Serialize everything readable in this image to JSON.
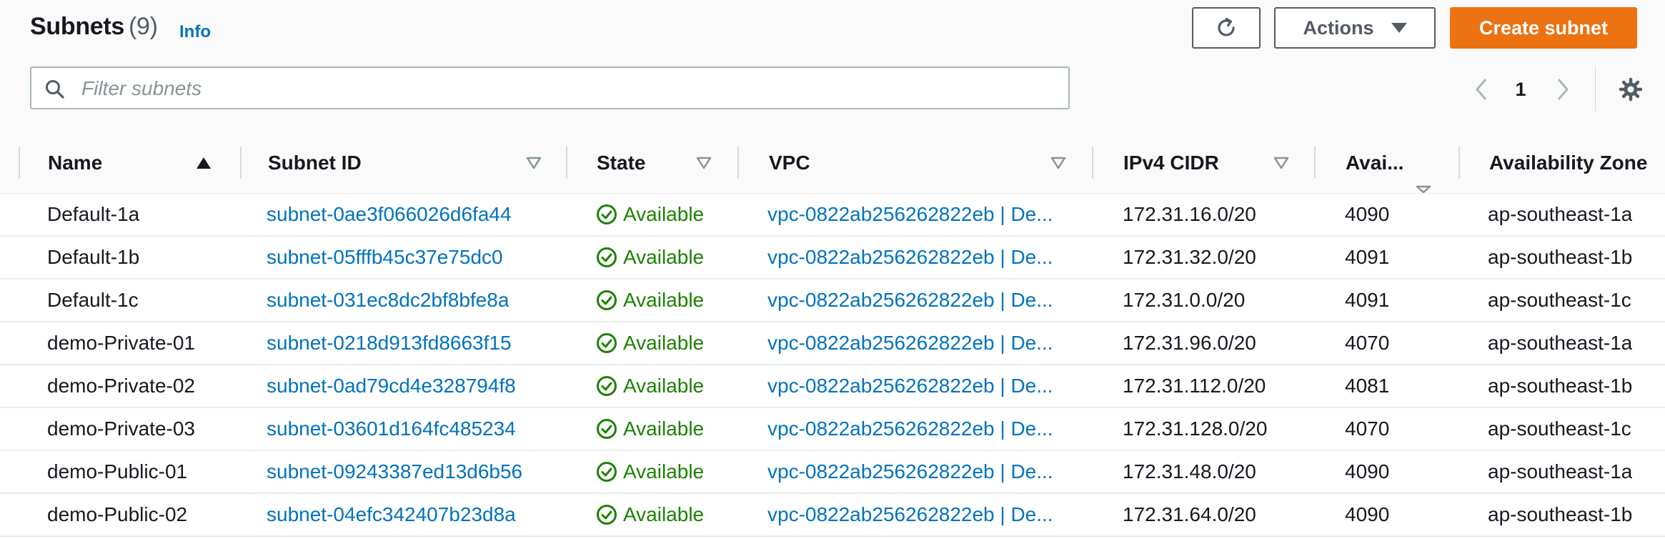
{
  "header": {
    "title": "Subnets",
    "count": "(9)",
    "info_label": "Info",
    "actions_label": "Actions",
    "create_label": "Create subnet"
  },
  "search": {
    "placeholder": "Filter subnets",
    "value": ""
  },
  "pagination": {
    "page": "1"
  },
  "columns": {
    "name": "Name",
    "subnet_id": "Subnet ID",
    "state": "State",
    "vpc": "VPC",
    "cidr": "IPv4 CIDR",
    "avail_ips": "Avai...",
    "az": "Availability Zone"
  },
  "rows": [
    {
      "name": "Default-1a",
      "subnet_id": "subnet-0ae3f066026d6fa44",
      "state": "Available",
      "vpc": "vpc-0822ab256262822eb | De...",
      "cidr": "172.31.16.0/20",
      "avail": "4090",
      "az": "ap-southeast-1a"
    },
    {
      "name": "Default-1b",
      "subnet_id": "subnet-05fffb45c37e75dc0",
      "state": "Available",
      "vpc": "vpc-0822ab256262822eb | De...",
      "cidr": "172.31.32.0/20",
      "avail": "4091",
      "az": "ap-southeast-1b"
    },
    {
      "name": "Default-1c",
      "subnet_id": "subnet-031ec8dc2bf8bfe8a",
      "state": "Available",
      "vpc": "vpc-0822ab256262822eb | De...",
      "cidr": "172.31.0.0/20",
      "avail": "4091",
      "az": "ap-southeast-1c"
    },
    {
      "name": "demo-Private-01",
      "subnet_id": "subnet-0218d913fd8663f15",
      "state": "Available",
      "vpc": "vpc-0822ab256262822eb | De...",
      "cidr": "172.31.96.0/20",
      "avail": "4070",
      "az": "ap-southeast-1a"
    },
    {
      "name": "demo-Private-02",
      "subnet_id": "subnet-0ad79cd4e328794f8",
      "state": "Available",
      "vpc": "vpc-0822ab256262822eb | De...",
      "cidr": "172.31.112.0/20",
      "avail": "4081",
      "az": "ap-southeast-1b"
    },
    {
      "name": "demo-Private-03",
      "subnet_id": "subnet-03601d164fc485234",
      "state": "Available",
      "vpc": "vpc-0822ab256262822eb | De...",
      "cidr": "172.31.128.0/20",
      "avail": "4070",
      "az": "ap-southeast-1c"
    },
    {
      "name": "demo-Public-01",
      "subnet_id": "subnet-09243387ed13d6b56",
      "state": "Available",
      "vpc": "vpc-0822ab256262822eb | De...",
      "cidr": "172.31.48.0/20",
      "avail": "4090",
      "az": "ap-southeast-1a"
    },
    {
      "name": "demo-Public-02",
      "subnet_id": "subnet-04efc342407b23d8a",
      "state": "Available",
      "vpc": "vpc-0822ab256262822eb | De...",
      "cidr": "172.31.64.0/20",
      "avail": "4090",
      "az": "ap-southeast-1b"
    }
  ],
  "icons": {
    "refresh": "refresh-icon",
    "actions_caret": "caret-down-icon",
    "search": "search-icon",
    "prev": "chevron-left-icon",
    "next": "chevron-right-icon",
    "settings": "gear-icon",
    "status": "check-circle-icon"
  },
  "colors": {
    "accent": "#ec7211",
    "link": "#0073bb",
    "success": "#1d8102",
    "text": "#16191f",
    "muted": "#545b64"
  }
}
